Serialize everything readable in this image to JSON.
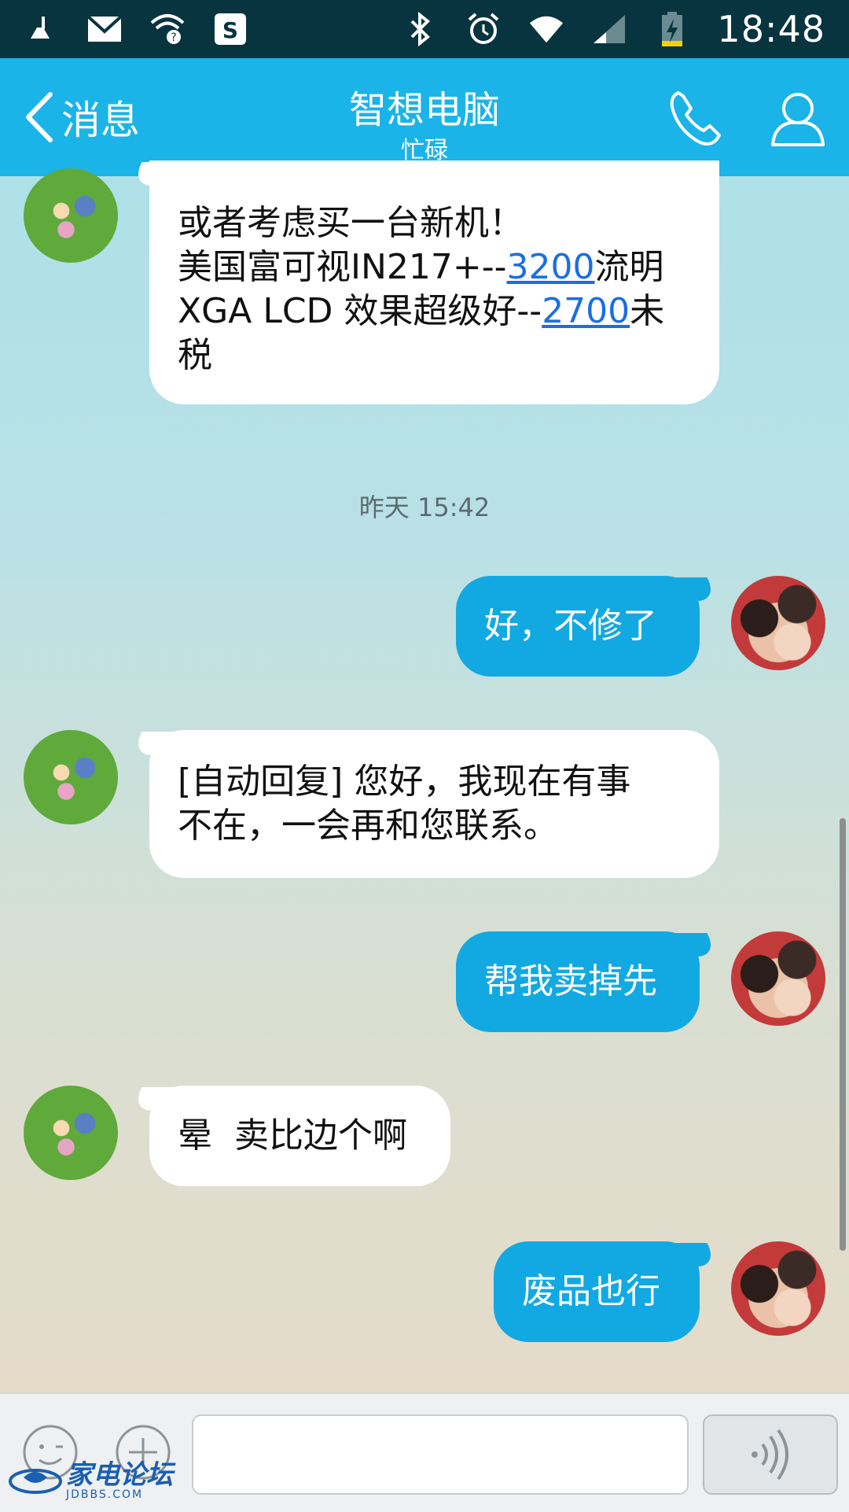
{
  "status_bar": {
    "time": "18:48",
    "left_icons": [
      "cleaner-icon",
      "mail-icon",
      "wifi-question-icon",
      "s-app-icon"
    ],
    "right_icons": [
      "bluetooth-icon",
      "alarm-icon",
      "wifi-icon",
      "signal-icon",
      "battery-charging-icon"
    ]
  },
  "header": {
    "back_label": "消息",
    "title": "智想电脑",
    "status": "忙碌",
    "accent": "#1ab4e8"
  },
  "messages": [
    {
      "side": "in",
      "lines": [
        "或者考虑买一台新机！"
      ],
      "line2_pre": "美国富可视IN217+--",
      "line2_link": "3200",
      "line2_post": "流明",
      "line3_pre": "XGA LCD 效果超级好--",
      "line3_link": "2700",
      "line3_post": "未",
      "line4": "税"
    },
    {
      "side": "out",
      "text": "好，不修了"
    },
    {
      "side": "in",
      "text_line1": "[自动回复] 您好，我现在有事",
      "text_line2": "不在，一会再和您联系。"
    },
    {
      "side": "out",
      "text": "帮我卖掉先"
    },
    {
      "side": "in",
      "text": "晕  卖比边个啊"
    },
    {
      "side": "out",
      "text": "废品也行"
    }
  ],
  "timestamp": "昨天 15:42",
  "input_bar": {
    "text_value": ""
  },
  "watermark": {
    "name": "家电论坛",
    "site": "JDBBS.COM"
  }
}
